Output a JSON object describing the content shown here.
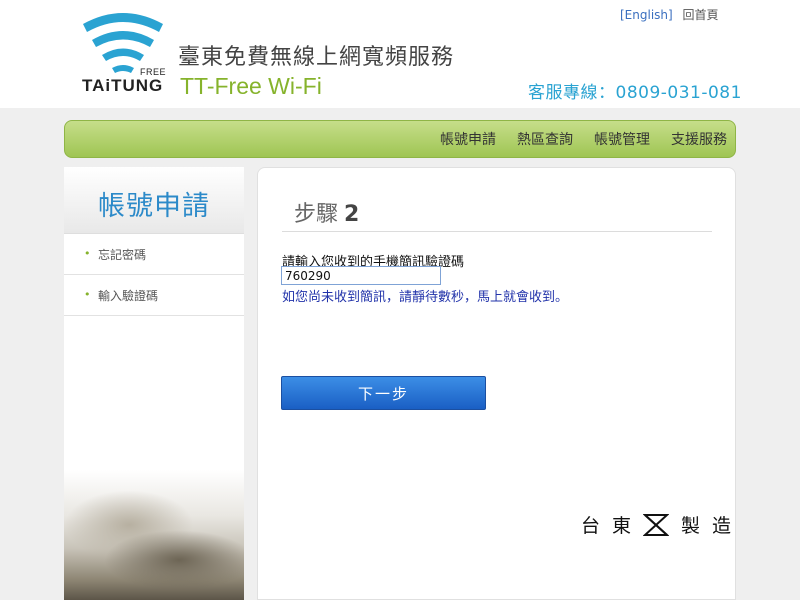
{
  "header": {
    "logo_free": "FREE",
    "logo_word": "TAiTUNG",
    "title_zh": "臺東免費無線上網寬頻服務",
    "title_en": "TT-Free Wi-Fi",
    "english_link": "[English]",
    "home_link": "回首頁",
    "hotline": "客服專線：0809-031-081"
  },
  "nav": {
    "items": [
      "帳號申請",
      "熱區查詢",
      "帳號管理",
      "支援服務"
    ]
  },
  "sidebar": {
    "title": "帳號申請",
    "items": [
      {
        "label": "忘記密碼"
      },
      {
        "label": "輸入驗證碼"
      }
    ]
  },
  "main": {
    "step_label": "步驟",
    "step_number": "2",
    "prompt": "請輸入您收到的手機簡訊驗證碼",
    "code_value": "760290",
    "hint": "如您尚未收到簡訊，請靜待數秒，馬上就會收到。",
    "next_button": "下一步"
  },
  "footer_brand": {
    "char1": "台",
    "char2": "東",
    "char3": "製",
    "char4": "造"
  },
  "colors": {
    "accent_blue": "#2c8ac9",
    "accent_green": "#86b32c",
    "hotline_blue": "#2aa3d2",
    "button_blue": "#1a5fc4"
  },
  "icons": {
    "logo": "wifi-signal-icon",
    "brand_symbol": "hourglass-icon"
  }
}
